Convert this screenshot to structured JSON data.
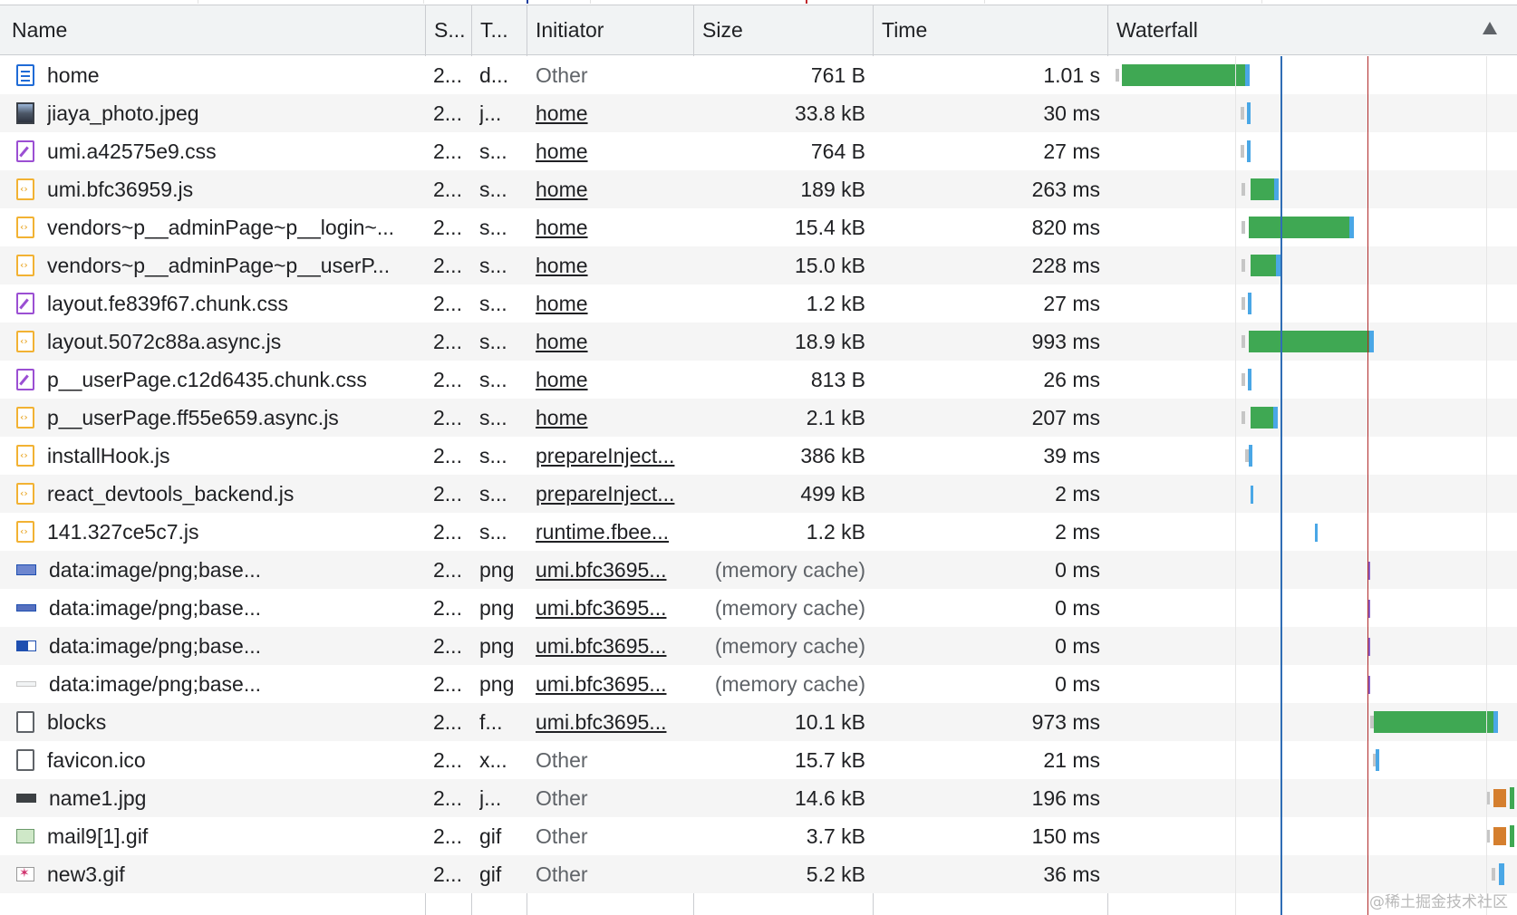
{
  "columns": {
    "name": "Name",
    "status": "S...",
    "type": "T...",
    "initiator": "Initiator",
    "size": "Size",
    "time": "Time",
    "waterfall": "Waterfall"
  },
  "rows": [
    {
      "name": "home",
      "icon": "document-icon",
      "status": "2...",
      "type": "d...",
      "initiator": "Other",
      "initiator_link": false,
      "size": "761 B",
      "time": "1.01 s"
    },
    {
      "name": "jiaya_photo.jpeg",
      "icon": "photo-icon",
      "status": "2...",
      "type": "j...",
      "initiator": "home",
      "initiator_link": true,
      "size": "33.8 kB",
      "time": "30 ms"
    },
    {
      "name": "umi.a42575e9.css",
      "icon": "stylesheet-icon",
      "status": "2...",
      "type": "s...",
      "initiator": "home",
      "initiator_link": true,
      "size": "764 B",
      "time": "27 ms"
    },
    {
      "name": "umi.bfc36959.js",
      "icon": "script-icon",
      "status": "2...",
      "type": "s...",
      "initiator": "home",
      "initiator_link": true,
      "size": "189 kB",
      "time": "263 ms"
    },
    {
      "name": "vendors~p__adminPage~p__login~...",
      "icon": "script-icon",
      "status": "2...",
      "type": "s...",
      "initiator": "home",
      "initiator_link": true,
      "size": "15.4 kB",
      "time": "820 ms"
    },
    {
      "name": "vendors~p__adminPage~p__userP...",
      "icon": "script-icon",
      "status": "2...",
      "type": "s...",
      "initiator": "home",
      "initiator_link": true,
      "size": "15.0 kB",
      "time": "228 ms"
    },
    {
      "name": "layout.fe839f67.chunk.css",
      "icon": "stylesheet-icon",
      "status": "2...",
      "type": "s...",
      "initiator": "home",
      "initiator_link": true,
      "size": "1.2 kB",
      "time": "27 ms"
    },
    {
      "name": "layout.5072c88a.async.js",
      "icon": "script-icon",
      "status": "2...",
      "type": "s...",
      "initiator": "home",
      "initiator_link": true,
      "size": "18.9 kB",
      "time": "993 ms"
    },
    {
      "name": "p__userPage.c12d6435.chunk.css",
      "icon": "stylesheet-icon",
      "status": "2...",
      "type": "s...",
      "initiator": "home",
      "initiator_link": true,
      "size": "813 B",
      "time": "26 ms"
    },
    {
      "name": "p__userPage.ff55e659.async.js",
      "icon": "script-icon",
      "status": "2...",
      "type": "s...",
      "initiator": "home",
      "initiator_link": true,
      "size": "2.1 kB",
      "time": "207 ms"
    },
    {
      "name": "installHook.js",
      "icon": "script-icon",
      "status": "2...",
      "type": "s...",
      "initiator": "prepareInject...",
      "initiator_link": true,
      "size": "386 kB",
      "time": "39 ms"
    },
    {
      "name": "react_devtools_backend.js",
      "icon": "script-icon",
      "status": "2...",
      "type": "s...",
      "initiator": "prepareInject...",
      "initiator_link": true,
      "size": "499 kB",
      "time": "2 ms"
    },
    {
      "name": "141.327ce5c7.js",
      "icon": "script-icon",
      "status": "2...",
      "type": "s...",
      "initiator": "runtime.fbee...",
      "initiator_link": true,
      "size": "1.2 kB",
      "time": "2 ms"
    },
    {
      "name": "data:image/png;base...",
      "icon": "image-icon",
      "status": "2...",
      "type": "png",
      "initiator": "umi.bfc3695...",
      "initiator_link": true,
      "size": "(memory cache)",
      "time": "0 ms"
    },
    {
      "name": "data:image/png;base...",
      "icon": "image-icon",
      "status": "2...",
      "type": "png",
      "initiator": "umi.bfc3695...",
      "initiator_link": true,
      "size": "(memory cache)",
      "time": "0 ms"
    },
    {
      "name": "data:image/png;base...",
      "icon": "image-icon",
      "status": "2...",
      "type": "png",
      "initiator": "umi.bfc3695...",
      "initiator_link": true,
      "size": "(memory cache)",
      "time": "0 ms"
    },
    {
      "name": "data:image/png;base...",
      "icon": "image-icon",
      "status": "2...",
      "type": "png",
      "initiator": "umi.bfc3695...",
      "initiator_link": true,
      "size": "(memory cache)",
      "time": "0 ms"
    },
    {
      "name": "blocks",
      "icon": "file-icon",
      "status": "2...",
      "type": "f...",
      "initiator": "umi.bfc3695...",
      "initiator_link": true,
      "size": "10.1 kB",
      "time": "973 ms"
    },
    {
      "name": "favicon.ico",
      "icon": "file-icon",
      "status": "2...",
      "type": "x...",
      "initiator": "Other",
      "initiator_link": false,
      "size": "15.7 kB",
      "time": "21 ms"
    },
    {
      "name": "name1.jpg",
      "icon": "image-icon",
      "status": "2...",
      "type": "j...",
      "initiator": "Other",
      "initiator_link": false,
      "size": "14.6 kB",
      "time": "196 ms"
    },
    {
      "name": "mail9[1].gif",
      "icon": "image-icon",
      "status": "2...",
      "type": "gif",
      "initiator": "Other",
      "initiator_link": false,
      "size": "3.7 kB",
      "time": "150 ms"
    },
    {
      "name": "new3.gif",
      "icon": "image-icon",
      "status": "2...",
      "type": "gif",
      "initiator": "Other",
      "initiator_link": false,
      "size": "5.2 kB",
      "time": "36 ms"
    }
  ],
  "watermark": "@稀土掘金技术社区",
  "colors": {
    "receiving_bar": "#3fa853",
    "waiting_marker": "#4aa7e6",
    "dom_content_loaded_line": "#2f6db5",
    "load_line": "#b02b2b"
  }
}
